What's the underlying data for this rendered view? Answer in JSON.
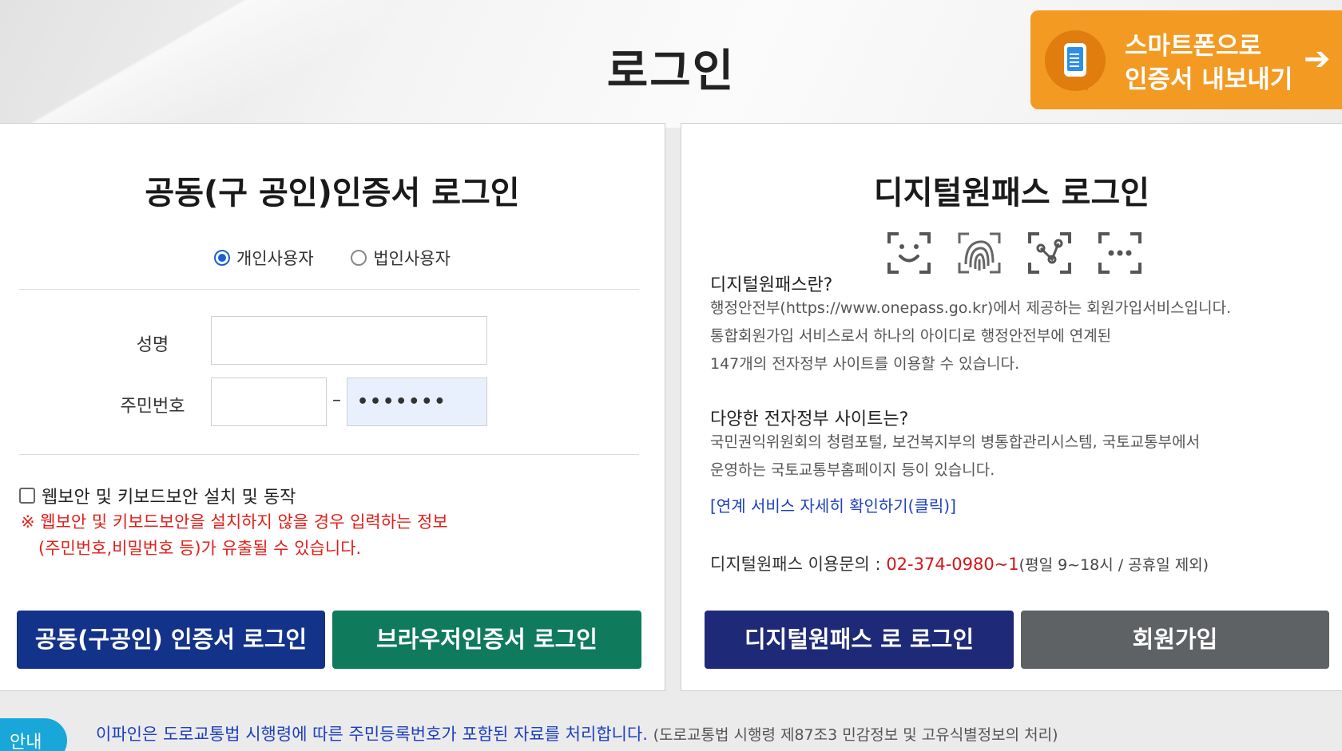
{
  "header": {
    "title": "로그인",
    "export_button": {
      "line1": "스마트폰으로",
      "line2": "인증서 내보내기",
      "icon": "smartphone-icon",
      "arrow_icon": "arrow-right-icon",
      "color": "#f29a22"
    }
  },
  "left_panel": {
    "title": "공동(구 공인)인증서 로그인",
    "user_types": [
      {
        "label": "개인사용자",
        "selected": true
      },
      {
        "label": "법인사용자",
        "selected": false
      }
    ],
    "name_label": "성명",
    "name_value": "",
    "rrn_label": "주민번호",
    "rrn_front_value": "",
    "rrn_separator": "–",
    "rrn_back_value": "•••••••",
    "security_checkbox_label": "웹보안 및 키보드보안 설치 및 동작",
    "warning_line1": "※ 웹보안 및 키보드보안을 설치하지 않을 경우 입력하는 정보",
    "warning_line2": "(주민번호,비밀번호 등)가 유출될 수 있습니다.",
    "cert_login_button": "공동(구공인) 인증서 로그인",
    "browser_cert_button": "브라우저인증서 로그인",
    "colors": {
      "cert_button": "#13338a",
      "browser_button": "#0f7a5c",
      "warning": "#e0201b"
    }
  },
  "right_panel": {
    "title": "디지털원패스 로그인",
    "auth_icons": [
      "face-recognition-icon",
      "fingerprint-icon",
      "pattern-icon",
      "pin-icon"
    ],
    "about_heading": "디지털원패스란?",
    "about_line1": "행정안전부(https://www.onepass.go.kr)에서 제공하는 회원가입서비스입니다.",
    "about_line2": "통합회원가입 서비스로서 하나의 아이디로 행정안전부에 연계된",
    "about_line3": "147개의 전자정부 사이트를 이용할 수 있습니다.",
    "sites_heading": "다양한 전자정부 사이트는?",
    "sites_line1": "국민권익위원회의 청렴포털, 보건복지부의 병통합관리시스템, 국토교통부에서",
    "sites_line2": "운영하는 국토교통부홈페이지 등이 있습니다.",
    "link": "[연계 서비스 자세히 확인하기(클릭)]",
    "contact_label": "디지털원패스 이용문의",
    "contact_sep": " : ",
    "contact_phone": "02-374-0980~1",
    "contact_hours": "(평일 9~18시 / 공휴일 제외)",
    "onepass_login_button": "디지털원패스 로 로그인",
    "signup_button": "회원가입",
    "colors": {
      "onepass_button": "#1e2a78",
      "signup_button": "#5f6265"
    }
  },
  "notice": {
    "badge": "안내",
    "text": "이파인은 도로교통법 시행령에 따른 주민등록번호가 포함된 자료를 처리합니다.",
    "sub": "(도로교통법 시행령 제87조3 민감정보 및 고유식별정보의 처리)"
  }
}
